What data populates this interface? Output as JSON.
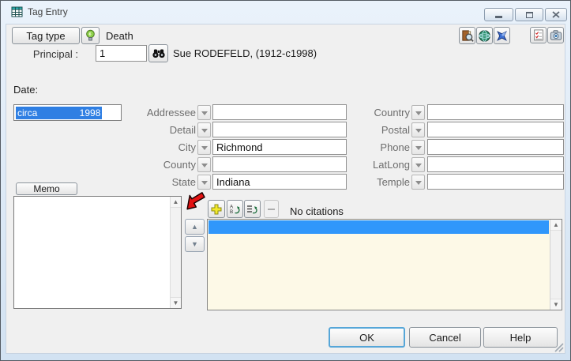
{
  "window": {
    "title": "Tag Entry"
  },
  "header": {
    "tag_type_button": "Tag type",
    "tag_type_value": "Death",
    "principal_label": "Principal :",
    "principal_value": "1",
    "principal_name": "Sue RODEFELD, (1912-c1998)"
  },
  "date": {
    "label": "Date:",
    "value": "circa                1998"
  },
  "fields": {
    "middle": [
      {
        "label": "Addressee",
        "value": ""
      },
      {
        "label": "Detail",
        "value": ""
      },
      {
        "label": "City",
        "value": "Richmond"
      },
      {
        "label": "County",
        "value": ""
      },
      {
        "label": "State",
        "value": "Indiana"
      }
    ],
    "right": [
      {
        "label": "Country",
        "value": ""
      },
      {
        "label": "Postal",
        "value": ""
      },
      {
        "label": "Phone",
        "value": ""
      },
      {
        "label": "LatLong",
        "value": ""
      },
      {
        "label": "Temple",
        "value": ""
      }
    ]
  },
  "memo": {
    "button_label": "Memo",
    "content": ""
  },
  "citations": {
    "status_text": "No citations"
  },
  "footer": {
    "ok_label": "OK",
    "cancel_label": "Cancel",
    "help_label": "Help"
  },
  "icons": {
    "up_arrow": "▲",
    "down_arrow": "▼"
  },
  "colors": {
    "frame_blue": "#d8e6f4",
    "selection_blue": "#2f7fe3",
    "list_selected_blue": "#3097fb",
    "list_bg_cream": "#fdf9e7"
  }
}
